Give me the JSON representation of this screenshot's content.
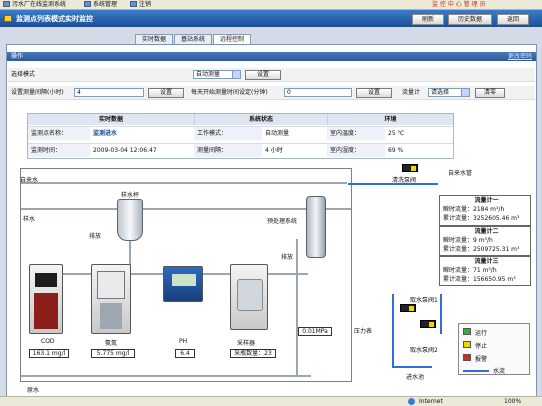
{
  "menu": {
    "items": [
      {
        "label": "污水厂在线监测系统",
        "icon": "folder-icon"
      },
      {
        "label": "系统管理",
        "icon": "settings-icon"
      },
      {
        "label": "注销",
        "icon": "logout-icon"
      }
    ],
    "right_link": "监 控 中 心   管 理 员"
  },
  "titlebar": {
    "title": "监测点列表模式实时监控",
    "buttons": [
      "刷新",
      "历史数据",
      "返回"
    ]
  },
  "tabs": [
    "实时数据",
    "基站系统",
    "远程控制"
  ],
  "operations": {
    "header": "操作",
    "change_password": "更改密码",
    "mode_label": "选择模式",
    "mode_value": "自动测量",
    "mode_set": "设置",
    "interval_label": "设置测量间隔(小时)",
    "interval_value": "4",
    "interval_set": "设置",
    "start_label": "每天开始测量时间设定(分钟)",
    "start_value": "0",
    "start_set": "设置",
    "flowmeter_label": "流量计",
    "flowmeter_value": "请选择",
    "flowmeter_clear": "清零"
  },
  "info": {
    "headers": [
      "实时数据",
      "系统状态",
      "环境"
    ],
    "rows": [
      [
        "监测点名称：",
        "监测进水",
        "工作模式：",
        "自动测量",
        "室内温度：",
        "25 ℃"
      ],
      [
        "监测时间：",
        "2009-03-04 12:06:47",
        "测量间隔：",
        "4 小时",
        "室内湿度：",
        "69 %"
      ]
    ]
  },
  "diagram": {
    "labels": {
      "tap_water_left": "自来水",
      "sample_cup": "样水杯",
      "sample_water": "样水",
      "drain1": "排放",
      "pretreatment": "预处理系统",
      "drain2": "排放",
      "wash_valve": "清洗泵阀",
      "tap_water_pipe": "自来水管",
      "pressure_gauge": "压力表",
      "pump_valve1": "取水泵阀1",
      "pump_valve2": "取水泵阀2",
      "intake_tank": "进水池",
      "raw_water": "原水",
      "pressure_value": "0.01MPa"
    },
    "instruments": [
      {
        "name": "COD",
        "value": "163.1 mg/l"
      },
      {
        "name": "氨氮",
        "value": "5.775 mg/l"
      },
      {
        "name": "PH",
        "value": "6.4"
      },
      {
        "name": "采样器",
        "value": "采瓶数量：23"
      }
    ],
    "flowmeters": [
      {
        "title": "流量计一",
        "instant": "瞬时流量：2184 m³/h",
        "total": "累计流量：3252605.46 m³"
      },
      {
        "title": "流量计二",
        "instant": "瞬时流量：9 m³/h",
        "total": "累计流量：2509725.31 m³"
      },
      {
        "title": "流量计三",
        "instant": "瞬时流量：71 m³/h",
        "total": "累计流量：156650.95 m³"
      }
    ],
    "legend": [
      {
        "label": "运行",
        "color": "#33b233"
      },
      {
        "label": "停止",
        "color": "#f3d400"
      },
      {
        "label": "报警",
        "color": "#d62a1e"
      },
      {
        "label": "水流",
        "color": "#2f6fd1"
      }
    ]
  },
  "statusbar": {
    "zone": "Internet",
    "zoom": "100%"
  }
}
